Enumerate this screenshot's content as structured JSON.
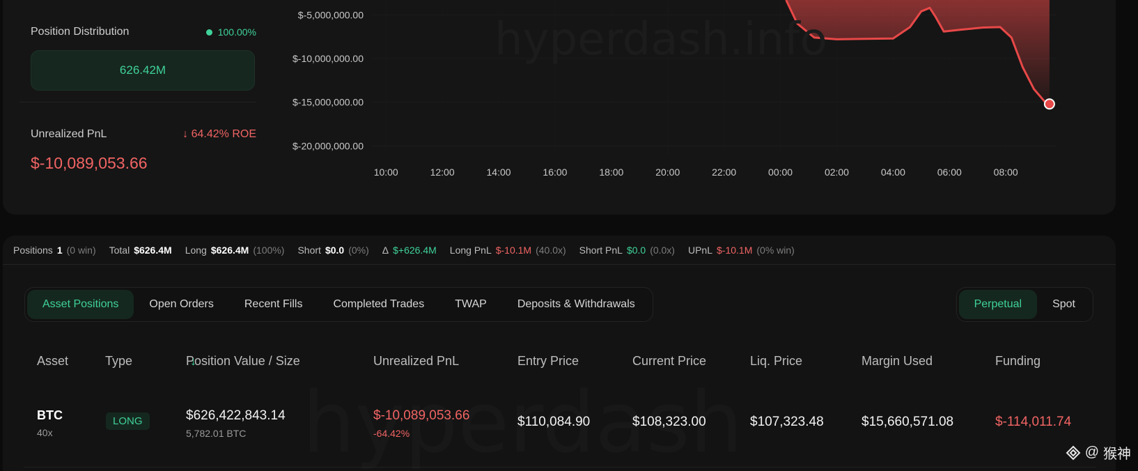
{
  "position_distribution": {
    "title": "Position Distribution",
    "percent": "100.00%",
    "bar_value": "626.42M"
  },
  "unrealized_pnl": {
    "title": "Unrealized PnL",
    "roe": "64.42% ROE",
    "value": "$-10,089,053.66"
  },
  "watermark": "hyperdash.info",
  "watermark_bottom": "hyperdash",
  "chart_data": {
    "type": "area",
    "title": "",
    "xlabel": "",
    "ylabel": "",
    "y_tick_labels": [
      "$-5,000,000.00",
      "$-10,000,000.00",
      "$-15,000,000.00",
      "$-20,000,000.00"
    ],
    "y_ticks": [
      -5000000,
      -10000000,
      -15000000,
      -20000000
    ],
    "x_tick_labels": [
      "10:00",
      "12:00",
      "14:00",
      "16:00",
      "18:00",
      "20:00",
      "22:00",
      "00:00",
      "02:00",
      "04:00",
      "06:00",
      "08:00"
    ],
    "x_ticks": [
      10,
      12,
      14,
      16,
      18,
      20,
      22,
      24,
      26,
      28,
      30,
      32
    ],
    "xlim": [
      9.5,
      33.8
    ],
    "ylim": [
      -21000000,
      -3300000
    ],
    "series": [
      {
        "color": "#e84848",
        "x": [
          24.2,
          24.6,
          25.2,
          26.0,
          27.0,
          28.0,
          28.6,
          29.0,
          29.3,
          29.5,
          29.8,
          30.4,
          31.2,
          31.8,
          32.2,
          32.6,
          33.0,
          33.4,
          33.55
        ],
        "y": [
          -3300000,
          -6000000,
          -7600000,
          -7800000,
          -7750000,
          -7700000,
          -6400000,
          -4600000,
          -4200000,
          -5200000,
          -6900000,
          -6700000,
          -6450000,
          -6400000,
          -7600000,
          -11000000,
          -13500000,
          -15000000,
          -15200000
        ]
      }
    ]
  },
  "stats": {
    "positions_label": "Positions",
    "positions_val": "1",
    "positions_sub": "(0 win)",
    "total_label": "Total",
    "total_val": "$626.4M",
    "long_label": "Long",
    "long_val": "$626.4M",
    "long_sub": "(100%)",
    "short_label": "Short",
    "short_val": "$0.0",
    "short_sub": "(0%)",
    "delta_label": "Δ",
    "delta_val": "$+626.4M",
    "longpnl_label": "Long PnL",
    "longpnl_val": "$-10.1M",
    "longpnl_sub": "(40.0x)",
    "shortpnl_label": "Short PnL",
    "shortpnl_val": "$0.0",
    "shortpnl_sub": "(0.0x)",
    "upnl_label": "UPnL",
    "upnl_val": "$-10.1M",
    "upnl_sub": "(0% win)"
  },
  "tabs": [
    "Asset Positions",
    "Open Orders",
    "Recent Fills",
    "Completed Trades",
    "TWAP",
    "Deposits & Withdrawals"
  ],
  "market_toggle": [
    "Perpetual",
    "Spot"
  ],
  "table": {
    "headers": [
      "Asset",
      "Type",
      "Position Value / Size",
      "Unrealized PnL",
      "Entry Price",
      "Current Price",
      "Liq. Price",
      "Margin Used",
      "Funding"
    ],
    "row": {
      "asset": "BTC",
      "leverage": "40x",
      "type": "LONG",
      "position_value": "$626,422,843.14",
      "position_size": "5,782.01 BTC",
      "upnl": "$-10,089,053.66",
      "upnl_pct": "-64.42%",
      "entry_price": "$110,084.90",
      "current_price": "$108,323.00",
      "liq_price": "$107,323.48",
      "margin_used": "$15,660,571.08",
      "funding": "$-114,011.74"
    }
  },
  "corner": {
    "at": "@",
    "name": "猴神"
  },
  "colors": {
    "green": "#3fd29a",
    "red": "#f26464",
    "chart_line": "#e84848"
  }
}
